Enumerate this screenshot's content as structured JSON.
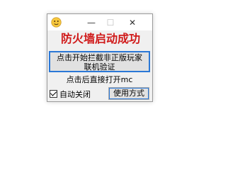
{
  "window": {
    "minimize_glyph": "—",
    "maximize_glyph": "☐",
    "close_glyph": "✕",
    "app_icon": "emoji-face-icon"
  },
  "main": {
    "headline": "防火墙启动成功",
    "headline_color": "#d01a1a",
    "intercept_button_line1": "点击开始拦截非正版玩家",
    "intercept_button_line2": "联机验证",
    "direct_open_button": "点击后直接打开mc",
    "auto_close_label": "自动关闭",
    "auto_close_checked": true,
    "usage_button": "使用方式"
  },
  "colors": {
    "accent_border": "#2b78d6"
  }
}
